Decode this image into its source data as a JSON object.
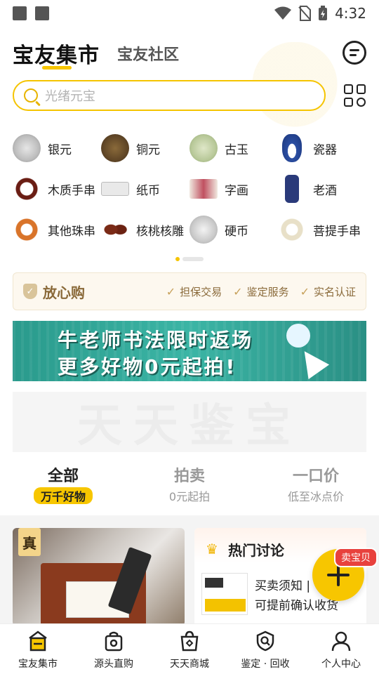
{
  "status_bar": {
    "time": "4:32"
  },
  "header": {
    "tab_active": "宝友集市",
    "tab_secondary": "宝友社区",
    "message_icon": "message-icon"
  },
  "search": {
    "placeholder": "光绪元宝"
  },
  "categories": [
    {
      "label": "银元"
    },
    {
      "label": "铜元"
    },
    {
      "label": "古玉"
    },
    {
      "label": "瓷器"
    },
    {
      "label": "木质手串"
    },
    {
      "label": "纸币"
    },
    {
      "label": "字画"
    },
    {
      "label": "老酒"
    },
    {
      "label": "其他珠串"
    },
    {
      "label": "核桃核雕"
    },
    {
      "label": "硬币"
    },
    {
      "label": "菩提手串"
    }
  ],
  "assurance": {
    "title": "放心购",
    "items": [
      "担保交易",
      "鉴定服务",
      "实名认证"
    ]
  },
  "banner": {
    "line1": "牛老师书法限时返场",
    "line2": "更多好物0元起拍!"
  },
  "watermark": "天天鉴宝",
  "filter_tabs": [
    {
      "title": "全部",
      "sub": "万千好物"
    },
    {
      "title": "拍卖",
      "sub": "0元起拍"
    },
    {
      "title": "一口价",
      "sub": "低至冰点价"
    }
  ],
  "feed": {
    "badge": "真",
    "hot_title": "热门讨论",
    "hot_line1": "买卖须知 |",
    "hot_line2": "可提前确认收货"
  },
  "fab": {
    "tag": "卖宝贝"
  },
  "bottom_nav": [
    {
      "label": "宝友集市"
    },
    {
      "label": "源头直购"
    },
    {
      "label": "天天商城"
    },
    {
      "label": "鉴定 · 回收"
    },
    {
      "label": "个人中心"
    }
  ],
  "colors": {
    "accent": "#f7c600",
    "gold_text": "#8a6a3a",
    "badge_red": "#e8413d"
  }
}
